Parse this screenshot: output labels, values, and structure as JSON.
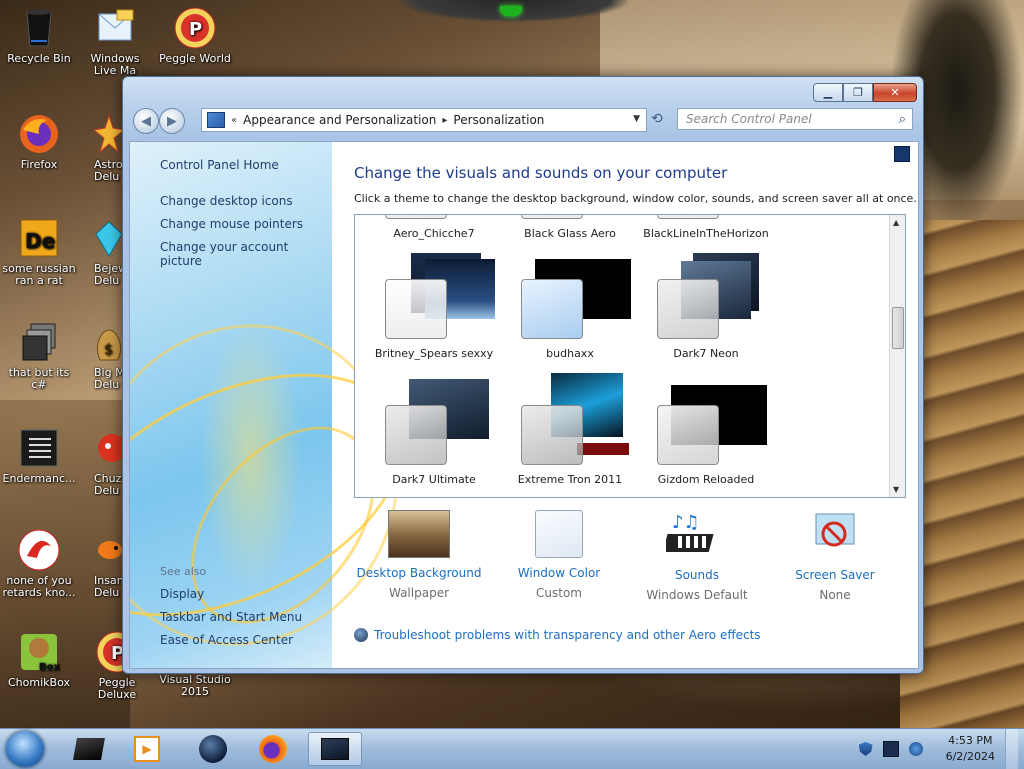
{
  "desktop": {
    "icons": [
      {
        "label": "Recycle Bin",
        "icon": "recycle-bin-icon"
      },
      {
        "label": "Windows Live Ma",
        "icon": "windows-live-mail-icon"
      },
      {
        "label": "Peggle World",
        "icon": "peggle-icon"
      },
      {
        "label": "Firefox",
        "icon": "firefox-icon"
      },
      {
        "label": "Astro Delu",
        "icon": "astro-icon"
      },
      {
        "label": "some russian ran a rat",
        "icon": "de-icon"
      },
      {
        "label": "Bejew Delu",
        "icon": "bejeweled-icon"
      },
      {
        "label": "that but its c#",
        "icon": "windows-stack-icon"
      },
      {
        "label": "Big M Delu",
        "icon": "money-bag-icon"
      },
      {
        "label": "Endermanc...",
        "icon": "document-icon"
      },
      {
        "label": "Chuz Delu",
        "icon": "chuzzle-icon"
      },
      {
        "label": "none of you retards kno...",
        "icon": "red-swirl-icon"
      },
      {
        "label": "Insaniq Delu",
        "icon": "insaniquarium-icon"
      },
      {
        "label": "ChomikBox",
        "icon": "chomikbox-icon"
      },
      {
        "label": "Peggle Deluxe",
        "icon": "peggle-icon"
      },
      {
        "label": "Visual Studio 2015",
        "icon": "visual-studio-icon"
      }
    ]
  },
  "window": {
    "caption_buttons": {
      "minimize": "▁",
      "maximize": "❐",
      "close": "✕"
    },
    "nav": {
      "back": "◀",
      "forward": "▶"
    },
    "breadcrumb": {
      "prefix": "«",
      "parent": "Appearance and Personalization",
      "separator": "▸",
      "current": "Personalization"
    },
    "search": {
      "placeholder": "Search Control Panel",
      "icon_glyph": "⌕"
    },
    "left_pane": {
      "home": "Control Panel Home",
      "links": [
        "Change desktop icons",
        "Change mouse pointers",
        "Change your account picture"
      ],
      "see_also_heading": "See also",
      "see_also": [
        "Display",
        "Taskbar and Start Menu",
        "Ease of Access Center"
      ]
    },
    "main": {
      "title": "Change the visuals and sounds on your computer",
      "subtitle": "Click a theme to change the desktop background, window color, sounds, and screen saver all at once.",
      "themes": [
        {
          "name": "Aero_Chicche7"
        },
        {
          "name": "Black Glass Aero"
        },
        {
          "name": "BlackLineInTheHorizon"
        },
        {
          "name": "Britney_Spears sexxy"
        },
        {
          "name": "budhaxx"
        },
        {
          "name": "Dark7 Neon"
        },
        {
          "name": "Dark7 Ultimate"
        },
        {
          "name": "Extreme Tron 2011"
        },
        {
          "name": "Gizdom Reloaded"
        }
      ],
      "bottom_items": [
        {
          "label": "Desktop Background",
          "value": "Wallpaper",
          "icon": "wallpaper-thumb-icon"
        },
        {
          "label": "Window Color",
          "value": "Custom",
          "icon": "window-color-icon"
        },
        {
          "label": "Sounds",
          "value": "Windows Default",
          "icon": "sounds-icon"
        },
        {
          "label": "Screen Saver",
          "value": "None",
          "icon": "screen-saver-icon"
        }
      ],
      "troubleshoot": "Troubleshoot problems with transparency and other Aero effects"
    }
  },
  "taskbar": {
    "pinned": [
      "device-icon",
      "media-player-icon",
      "globe-icon",
      "firefox-icon",
      "control-panel-icon"
    ],
    "clock": {
      "time": "4:53 PM",
      "date": "6/2/2024"
    }
  }
}
